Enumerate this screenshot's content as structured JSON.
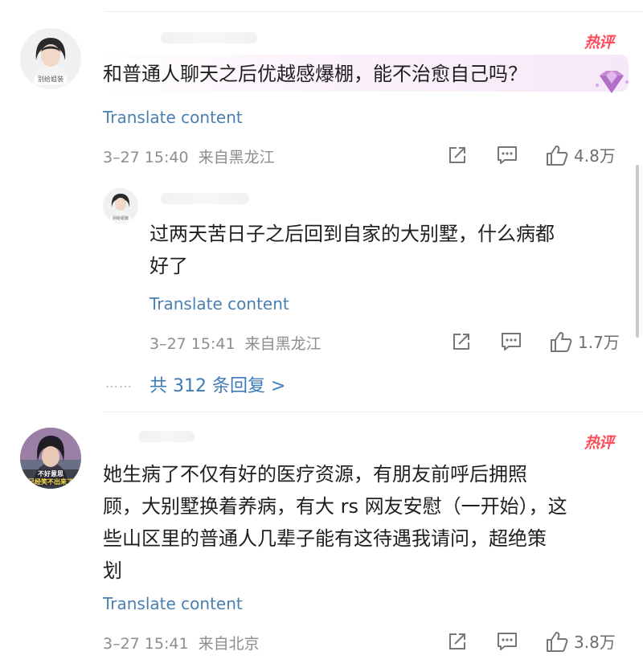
{
  "comments": [
    {
      "avatar_caption": "别给姐装",
      "badge": "热评",
      "text": "和普通人聊天之后优越感爆棚，能不治愈自己吗？",
      "translate_label": "Translate content",
      "date": "3–27 15:40",
      "location": "来自黑龙江",
      "likes": "4.8万",
      "reply": {
        "avatar_caption": "别给姐装",
        "text_line1": "过两天苦日子之后回到自家的大别墅，什么病都",
        "text_line2": "好了",
        "translate_label": "Translate content",
        "date": "3–27 15:41",
        "location": "来自黑龙江",
        "likes": "1.7万"
      },
      "more_replies": "共 312 条回复 >",
      "more_dots": "……"
    },
    {
      "avatar_caption_line1": "不好意思",
      "avatar_caption_line2": "已经笑不出来了",
      "badge": "热评",
      "text_line1": "她生病了不仅有好的医疗资源，有朋友前呼后拥照",
      "text_line2": "顾，大别墅换着养病，有大 rs 网友安慰（一开始），这",
      "text_line3": "些山区里的普通人几辈子能有这待遇我请问，超绝策",
      "text_line4": "划",
      "translate_label": "Translate content",
      "date": "3–27 15:41",
      "location": "来自北京",
      "likes": "3.8万"
    }
  ],
  "colors": {
    "link": "#4a7fb0",
    "hot": "#ff4d5a",
    "meta": "#8d8d8d"
  },
  "icons": [
    "share-icon",
    "comment-icon",
    "like-icon",
    "gem-badge-icon"
  ]
}
